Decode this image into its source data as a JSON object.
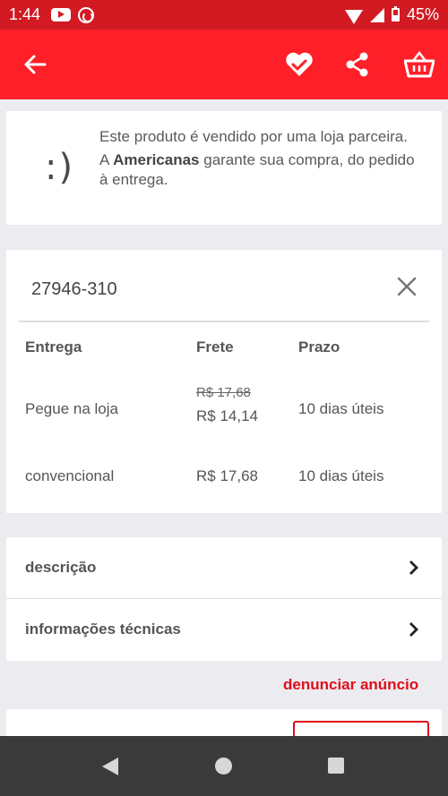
{
  "status_bar": {
    "time": "1:44",
    "battery": "45%",
    "icons": [
      "youtube-icon",
      "app-notification-icon",
      "wifi-icon",
      "signal-icon",
      "battery-icon"
    ]
  },
  "app_bar": {
    "color": "#ff1f28",
    "icons": [
      "back-arrow-icon",
      "heart-icon",
      "share-icon",
      "basket-icon"
    ]
  },
  "seller_card": {
    "smiley": ":)",
    "line1": "Este produto é vendido por uma loja parceira.",
    "line2_prefix": "A ",
    "line2_brand": "Americanas",
    "line2_suffix": " garante sua compra, do pedido à entrega."
  },
  "shipping": {
    "cep": "27946-310",
    "headers": {
      "entrega": "Entrega",
      "frete": "Frete",
      "prazo": "Prazo"
    },
    "rows": [
      {
        "entrega": "Pegue na loja",
        "frete_old": "R$ 17,68",
        "frete": "R$ 14,14",
        "prazo": "10 dias úteis"
      },
      {
        "entrega": "convencional",
        "frete": "R$ 17,68",
        "prazo": "10 dias úteis"
      }
    ]
  },
  "details": {
    "items": [
      {
        "label": "descrição"
      },
      {
        "label": "informações técnicas"
      }
    ]
  },
  "report_link": "denunciar anúncio",
  "accent_color": "#e10e1a"
}
